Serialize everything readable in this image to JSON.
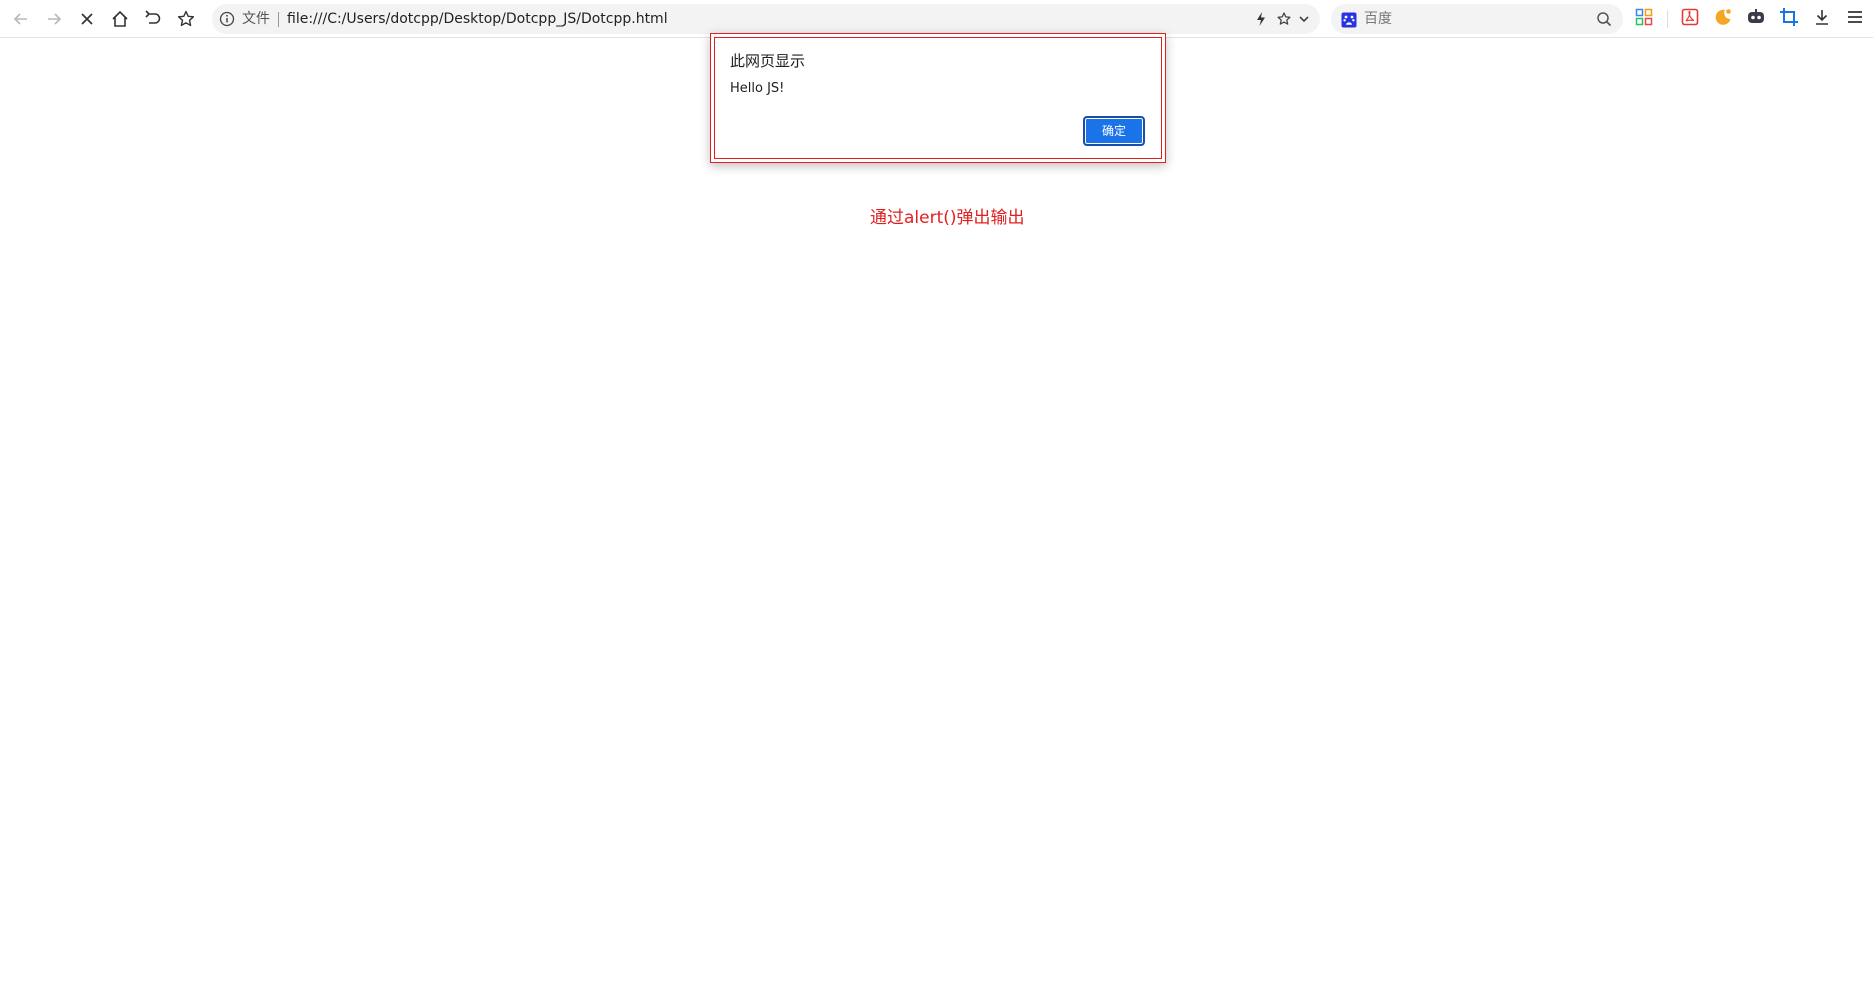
{
  "browser": {
    "address_bar": {
      "file_label": "文件",
      "url": "file:///C:/Users/dotcpp/Desktop/Dotcpp_JS/Dotcpp.html"
    },
    "search": {
      "placeholder": "百度"
    },
    "nav_icons": [
      "back-icon",
      "forward-icon",
      "stop-icon",
      "home-icon",
      "undo-icon",
      "favorite-star-icon"
    ],
    "extension_icons": [
      "apps-grid-icon",
      "pdf-icon",
      "night-mode-icon",
      "robot-icon",
      "crop-icon",
      "download-icon",
      "menu-icon"
    ]
  },
  "dialog": {
    "title": "此网页显示",
    "message": "Hello JS!",
    "ok_label": "确定"
  },
  "page": {
    "caption": "通过alert()弹出输出"
  },
  "colors": {
    "accent_blue": "#1a73e8",
    "annotation_red": "#e02020"
  }
}
